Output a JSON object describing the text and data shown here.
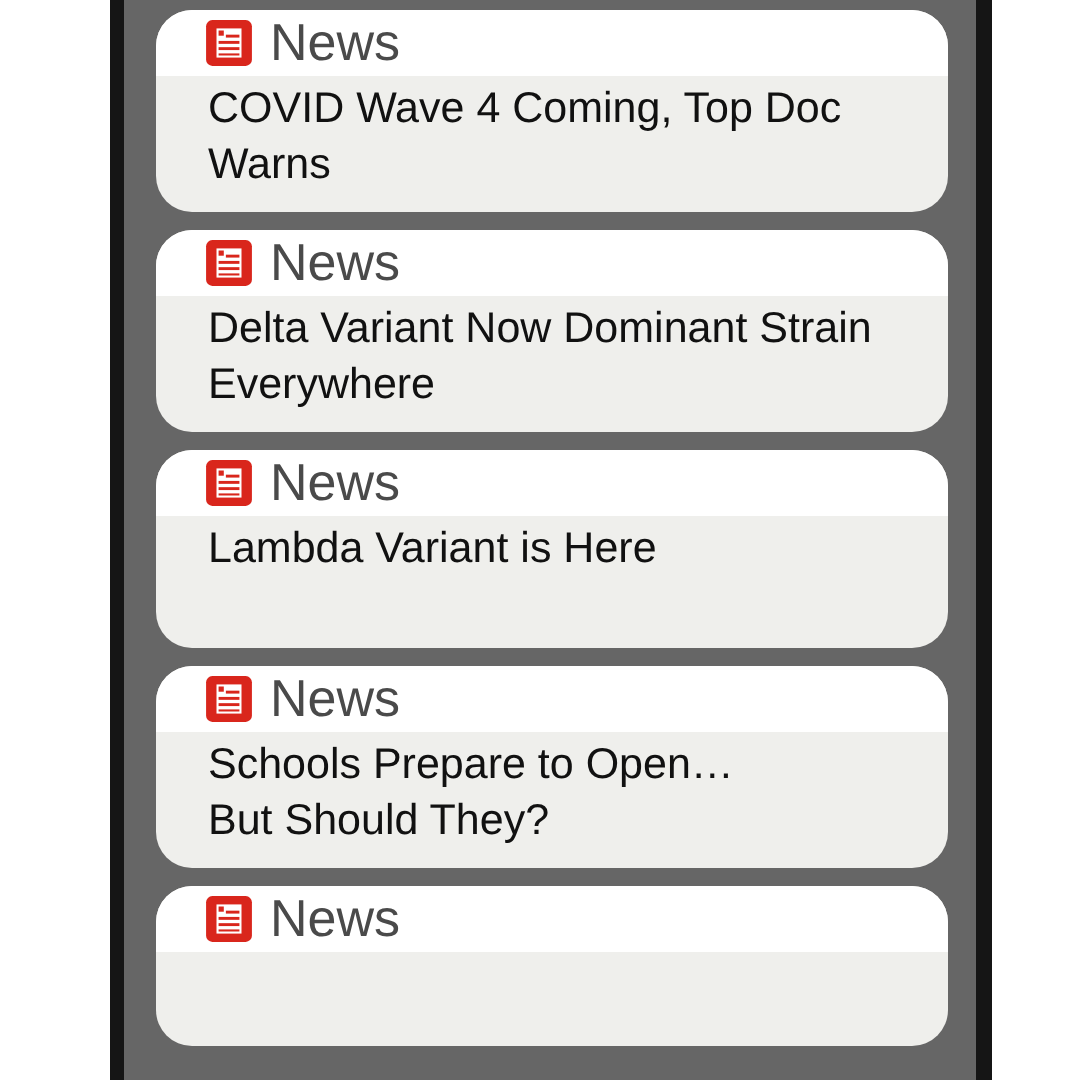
{
  "notifications": [
    {
      "app": "News",
      "headline": "COVID Wave 4 Coming, Top Doc Warns"
    },
    {
      "app": "News",
      "headline": "Delta Variant Now Dominant Strain Everywhere"
    },
    {
      "app": "News",
      "headline": "Lambda Variant is Here"
    },
    {
      "app": "News",
      "headline": "Schools Prepare to Open…\nBut Should They?"
    },
    {
      "app": "News"
    }
  ]
}
